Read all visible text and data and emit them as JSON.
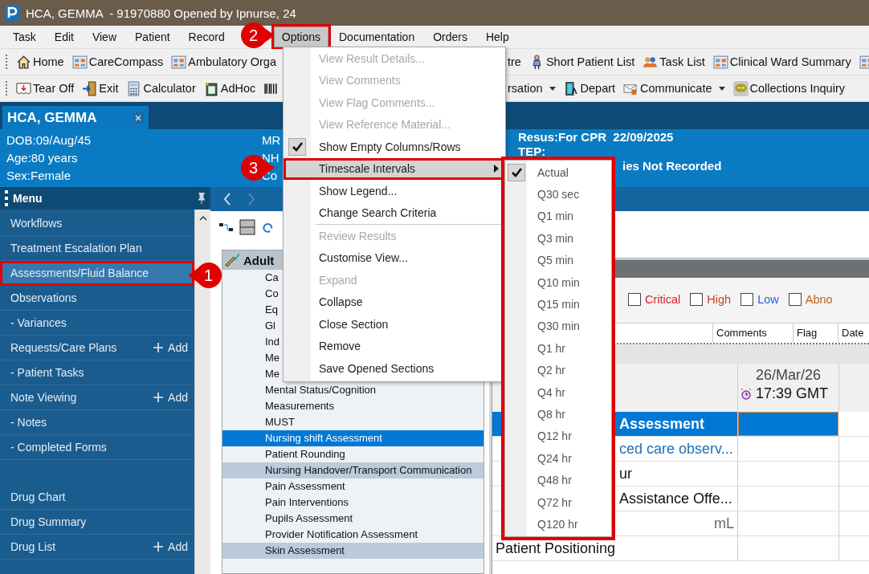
{
  "window": {
    "title": "HCA, GEMMA  - 91970880 Opened by Ipnurse, 24"
  },
  "menu_bar": [
    {
      "label": "Task",
      "selected": false
    },
    {
      "label": "Edit",
      "selected": false
    },
    {
      "label": "View",
      "selected": false
    },
    {
      "label": "Patient",
      "selected": false
    },
    {
      "label": "Record",
      "selected": false
    },
    {
      "label": "Options",
      "selected": true,
      "highlighted": true
    },
    {
      "label": "Documentation",
      "selected": false
    },
    {
      "label": "Orders",
      "selected": false
    },
    {
      "label": "Help",
      "selected": false
    }
  ],
  "toolbars": [
    {
      "left": [
        {
          "kind": "house",
          "label": "Home"
        },
        {
          "kind": "sheet",
          "label": "CareCompass"
        },
        {
          "kind": "sheet",
          "label": "Ambulatory Orga"
        }
      ],
      "right": [
        {
          "kind": "none",
          "label": "tre",
          "dropdown": false
        },
        {
          "kind": "person",
          "label": "Short Patient List",
          "dropdown": false
        },
        {
          "kind": "people",
          "label": "Task List",
          "dropdown": false
        },
        {
          "kind": "sheet",
          "label": "Clinical Ward Summary",
          "dropdown": false
        },
        {
          "kind": "sheet",
          "dropdown": false
        }
      ]
    },
    {
      "left": [
        {
          "kind": "tear",
          "label": "Tear Off"
        },
        {
          "kind": "door",
          "label": "Exit"
        },
        {
          "kind": "calculator",
          "label": "Calculator"
        },
        {
          "kind": "adhoc",
          "label": "AdHoc"
        },
        {
          "kind": "barcode"
        }
      ],
      "right": [
        {
          "kind": "none",
          "label": "rsation",
          "dropdown": true
        },
        {
          "kind": "depart",
          "label": "Depart",
          "dropdown": false
        },
        {
          "kind": "envelope",
          "label": "Communicate",
          "dropdown": true
        },
        {
          "kind": "bubble",
          "label": "Collections Inquiry",
          "dropdown": false
        }
      ]
    }
  ],
  "patient_tab": {
    "name": "HCA, GEMMA"
  },
  "banner": {
    "left": [
      "DOB:09/Aug/45",
      "Age:80 years",
      "Sex:Female"
    ],
    "middle": [
      "MR",
      "NH",
      "Co"
    ],
    "right": [
      "Resus:For CPR  22/09/2025",
      "TEP:",
      "ies Not Recorded"
    ]
  },
  "sidebar": {
    "title": "Menu",
    "items": [
      {
        "label": "Workflows",
        "selected": false,
        "highlighted": false
      },
      {
        "label": "Treatment Escalation Plan",
        "selected": false,
        "highlighted": false
      },
      {
        "label": "Assessments/Fluid Balance",
        "selected": true,
        "highlighted": true
      },
      {
        "label": "Observations",
        "selected": false,
        "highlighted": false
      },
      {
        "label": "- Variances",
        "selected": false,
        "highlighted": false
      },
      {
        "label": "Requests/Care Plans",
        "selected": false,
        "highlighted": false,
        "action": "Add"
      },
      {
        "label": "- Patient Tasks",
        "selected": false,
        "highlighted": false
      },
      {
        "label": "Note Viewing",
        "selected": false,
        "highlighted": false,
        "action": "Add"
      },
      {
        "label": "- Notes",
        "selected": false,
        "highlighted": false
      },
      {
        "label": "- Completed Forms",
        "selected": false,
        "highlighted": false
      }
    ],
    "lower_items": [
      {
        "label": "Drug Chart",
        "selected": false,
        "highlighted": false
      },
      {
        "label": "Drug Summary",
        "selected": false,
        "highlighted": false
      },
      {
        "label": "Drug List",
        "selected": false,
        "highlighted": false,
        "action": "Add"
      }
    ]
  },
  "section_list": {
    "title": "Adult",
    "items": [
      {
        "label": "Ca",
        "selected": false,
        "shaded": false
      },
      {
        "label": "Co",
        "selected": false,
        "shaded": false
      },
      {
        "label": "Eq",
        "selected": false,
        "shaded": false
      },
      {
        "label": "Gl",
        "selected": false,
        "shaded": false
      },
      {
        "label": "Ind",
        "selected": false,
        "shaded": false
      },
      {
        "label": "Me",
        "selected": false,
        "shaded": false
      },
      {
        "label": "Me",
        "selected": false,
        "shaded": false
      },
      {
        "label": "Mental Status/Cognition",
        "selected": false,
        "shaded": false
      },
      {
        "label": "Measurements",
        "selected": false,
        "shaded": false
      },
      {
        "label": "MUST",
        "selected": false,
        "shaded": false
      },
      {
        "label": "Nursing shift Assessment",
        "selected": true,
        "shaded": false
      },
      {
        "label": "Patient Rounding",
        "selected": false,
        "shaded": false
      },
      {
        "label": "Nursing Handover/Transport Communication",
        "selected": false,
        "shaded": true
      },
      {
        "label": "Pain Assessment",
        "selected": false,
        "shaded": false
      },
      {
        "label": "Pain Interventions",
        "selected": false,
        "shaded": false
      },
      {
        "label": "Pupils Assessment",
        "selected": false,
        "shaded": false
      },
      {
        "label": "Provider Notification Assessment",
        "selected": false,
        "shaded": false
      },
      {
        "label": "Skin Assessment",
        "selected": false,
        "shaded": true
      }
    ]
  },
  "filters": [
    {
      "label": "Critical",
      "checked": false,
      "color": "#e0202a"
    },
    {
      "label": "High",
      "checked": false,
      "color": "#d0401a"
    },
    {
      "label": "Low",
      "checked": false,
      "color": "#2a62e0"
    },
    {
      "label": "Abno",
      "checked": false,
      "color": "#c0601a"
    }
  ],
  "columns": [
    "Comments",
    "Flag",
    "Date"
  ],
  "grid": {
    "date": "26/Mar/26",
    "time": "17:39 GMT",
    "rows": [
      {
        "kind": "section",
        "label": "Assessment",
        "selected": true,
        "partial": true,
        "expandable": false
      },
      {
        "kind": "link",
        "label": "ced care observ...",
        "selected": false,
        "partial": true,
        "expandable": true
      },
      {
        "kind": "text",
        "label": "ur",
        "selected": false,
        "partial": true,
        "expandable": false
      },
      {
        "kind": "text",
        "label": "Assistance Offe...",
        "selected": false,
        "partial": true,
        "expandable": true
      },
      {
        "kind": "unit",
        "label": "mL",
        "selected": false,
        "expandable": false
      },
      {
        "kind": "text",
        "label": "Patient Positioning",
        "selected": false,
        "partial": false,
        "expandable": false
      }
    ]
  },
  "options_menu": {
    "items": [
      {
        "label": "View Result Details...",
        "disabled": true,
        "checked": false
      },
      {
        "label": "View Comments",
        "disabled": true,
        "checked": false
      },
      {
        "label": "View Flag Comments...",
        "disabled": true,
        "checked": false
      },
      {
        "label": "View Reference Material...",
        "disabled": true,
        "checked": false
      },
      {
        "label": "Show Empty Columns/Rows",
        "disabled": false,
        "checked": true
      },
      {
        "label": "Timescale Intervals",
        "disabled": false,
        "checked": false,
        "submenu": true,
        "selected": true,
        "highlighted": true
      },
      {
        "label": "Show Legend...",
        "disabled": false,
        "checked": false
      },
      {
        "label": "Change Search Criteria",
        "disabled": false,
        "checked": false,
        "separator_after": true
      },
      {
        "label": "Review Results",
        "disabled": true,
        "checked": false
      },
      {
        "label": "Customise View...",
        "disabled": false,
        "checked": false
      },
      {
        "label": "Expand",
        "disabled": true,
        "checked": false
      },
      {
        "label": "Collapse",
        "disabled": false,
        "checked": false
      },
      {
        "label": "Close Section",
        "disabled": false,
        "checked": false
      },
      {
        "label": "Remove",
        "disabled": false,
        "checked": false
      },
      {
        "label": "Save Opened Sections",
        "disabled": false,
        "checked": false
      }
    ]
  },
  "timescale_menu": {
    "highlighted": true,
    "items": [
      {
        "label": "Actual",
        "checked": true
      },
      {
        "label": "Q30 sec",
        "checked": false
      },
      {
        "label": "Q1 min",
        "checked": false
      },
      {
        "label": "Q3 min",
        "checked": false
      },
      {
        "label": "Q5 min",
        "checked": false
      },
      {
        "label": "Q10 min",
        "checked": false
      },
      {
        "label": "Q15 min",
        "checked": false
      },
      {
        "label": "Q30 min",
        "checked": false
      },
      {
        "label": "Q1 hr",
        "checked": false
      },
      {
        "label": "Q2 hr",
        "checked": false
      },
      {
        "label": "Q4 hr",
        "checked": false
      },
      {
        "label": "Q8 hr",
        "checked": false
      },
      {
        "label": "Q12 hr",
        "checked": false
      },
      {
        "label": "Q24 hr",
        "checked": false
      },
      {
        "label": "Q48 hr",
        "checked": false
      },
      {
        "label": "Q72 hr",
        "checked": false
      },
      {
        "label": "Q120 hr",
        "checked": false
      }
    ]
  },
  "callouts": [
    {
      "number": "1"
    },
    {
      "number": "2"
    },
    {
      "number": "3"
    }
  ]
}
